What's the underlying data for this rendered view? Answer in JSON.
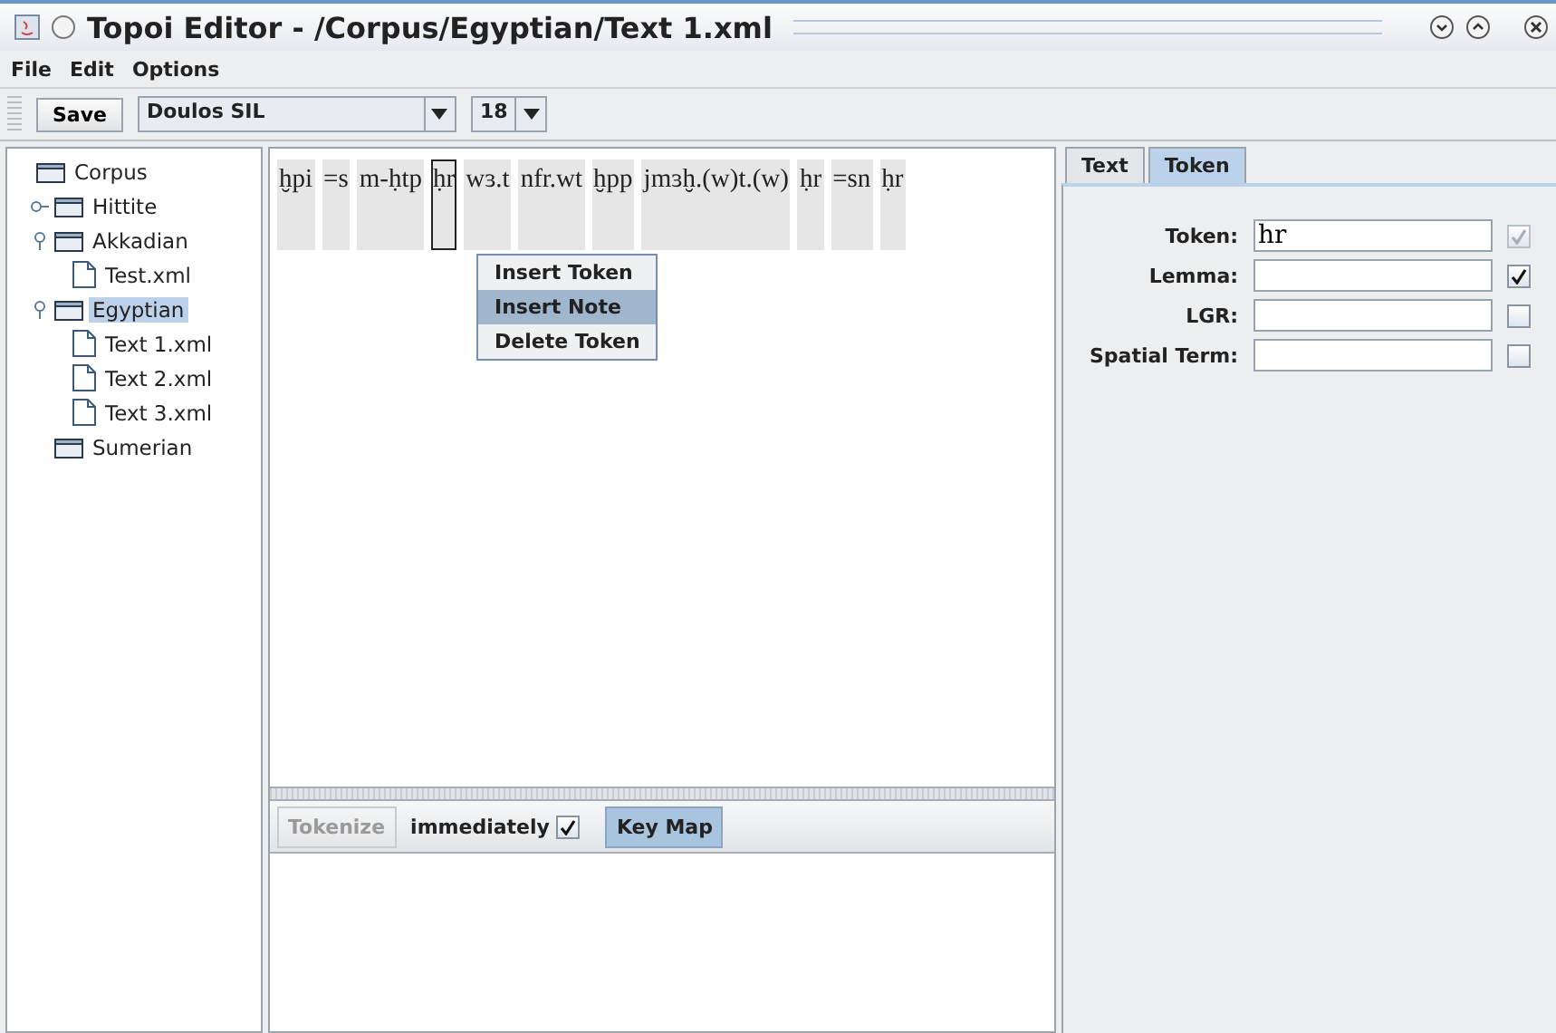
{
  "window": {
    "title": "Topoi Editor - /Corpus/Egyptian/Text 1.xml"
  },
  "menu": [
    "File",
    "Edit",
    "Options"
  ],
  "toolbar": {
    "save": "Save",
    "font": "Doulos SIL",
    "size": "18"
  },
  "tree": [
    {
      "label": "Corpus",
      "kind": "folder",
      "selected": false,
      "children": [
        {
          "label": "Hittite",
          "kind": "folder",
          "selected": false,
          "expanded": false
        },
        {
          "label": "Akkadian",
          "kind": "folder",
          "selected": false,
          "expanded": true,
          "children": [
            {
              "label": "Test.xml",
              "kind": "file",
              "selected": false
            }
          ]
        },
        {
          "label": "Egyptian",
          "kind": "folder",
          "selected": true,
          "expanded": true,
          "children": [
            {
              "label": "Text 1.xml",
              "kind": "file",
              "selected": false
            },
            {
              "label": "Text 2.xml",
              "kind": "file",
              "selected": false
            },
            {
              "label": "Text 3.xml",
              "kind": "file",
              "selected": false
            }
          ]
        },
        {
          "label": "Sumerian",
          "kind": "folder",
          "selected": false
        }
      ]
    }
  ],
  "tokens": [
    {
      "text": "ḫpi",
      "selected": false
    },
    {
      "text": "=s",
      "selected": false
    },
    {
      "text": "m-ḥtp",
      "selected": false
    },
    {
      "text": "ḥr",
      "selected": true
    },
    {
      "text": "wɜ.t",
      "selected": false
    },
    {
      "text": "nfr.wt",
      "selected": false
    },
    {
      "text": "ḫpp",
      "selected": false
    },
    {
      "text": "jmɜḫ.(w)t.(w)",
      "selected": false
    },
    {
      "text": "ḥr",
      "selected": false
    },
    {
      "text": "=sn",
      "selected": false
    },
    {
      "text": "ḥr",
      "selected": false
    }
  ],
  "context_menu": [
    {
      "label": "Insert Token",
      "selected": false
    },
    {
      "label": "Insert Note",
      "selected": true
    },
    {
      "label": "Delete Token",
      "selected": false
    }
  ],
  "bottom_toolbar": {
    "tokenize": {
      "label": "Tokenize",
      "disabled": true
    },
    "immediately": {
      "label": "immediately",
      "checked": true
    },
    "keymap": {
      "label": "Key Map",
      "selected": true
    }
  },
  "tabs": [
    {
      "label": "Text",
      "selected": false
    },
    {
      "label": "Token",
      "selected": true
    }
  ],
  "fields": [
    {
      "label": "Token:",
      "value": "hr",
      "checked": true,
      "disabled": true
    },
    {
      "label": "Lemma:",
      "checked": true,
      "disabled": false
    },
    {
      "label": "LGR:",
      "checked": false,
      "disabled": false
    },
    {
      "label": "Spatial Term:",
      "checked": false,
      "disabled": false
    }
  ]
}
